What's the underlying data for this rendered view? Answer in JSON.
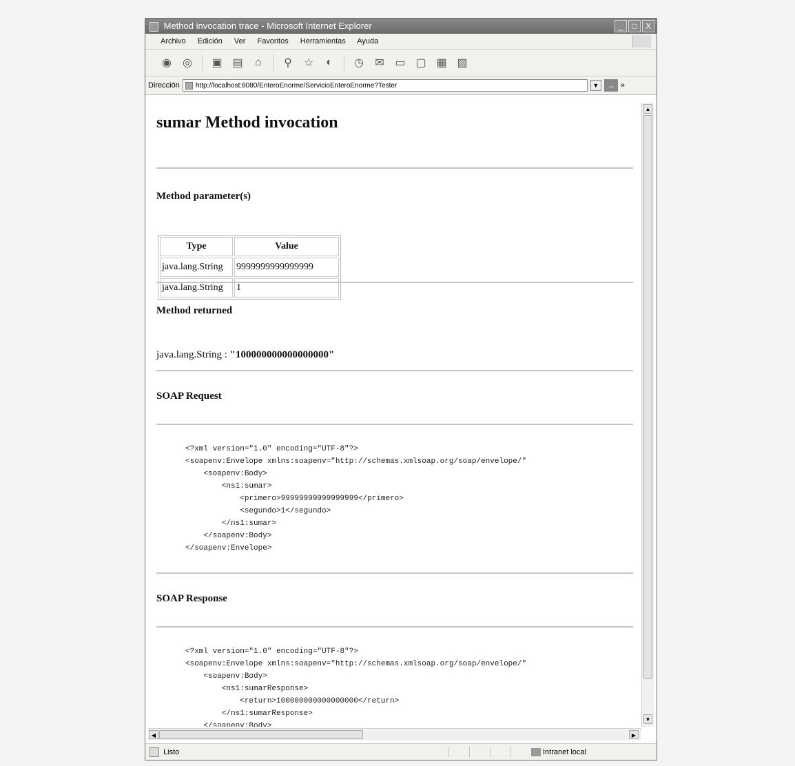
{
  "window": {
    "title": "Method invocation trace - Microsoft Internet Explorer",
    "controls": [
      "_",
      "□",
      "X"
    ]
  },
  "menu": [
    "Archivo",
    "Edición",
    "Ver",
    "Favoritos",
    "Herramientas",
    "Ayuda"
  ],
  "toolbar_icons": [
    "back-icon",
    "forward-icon",
    "stop-icon",
    "refresh-icon",
    "home-icon",
    "search-icon",
    "favorites-icon",
    "media-icon",
    "history-icon",
    "mail-icon",
    "print-icon",
    "edit-icon",
    "discuss-icon",
    "messenger-icon"
  ],
  "address": {
    "label": "Dirección",
    "url": "http://localhost:8080/EnteroEnorme/ServicioEnteroEnorme?Tester",
    "go_label": "→",
    "links_label": "»"
  },
  "page": {
    "title": "sumar Method invocation",
    "params_heading": "Method parameter(s)",
    "params_columns": [
      "Type",
      "Value"
    ],
    "params_rows": [
      {
        "type": "java.lang.String",
        "value": "9999999999999999"
      },
      {
        "type": "java.lang.String",
        "value": "1"
      }
    ],
    "returned_heading": "Method returned",
    "returned_type": "java.lang.String : ",
    "returned_value": "\"100000000000000000\"",
    "soap_request_heading": "SOAP Request",
    "soap_request": "<?xml version=\"1.0\" encoding=\"UTF-8\"?>\n<soapenv:Envelope xmlns:soapenv=\"http://schemas.xmlsoap.org/soap/envelope/\"\n    <soapenv:Body>\n        <ns1:sumar>\n            <primero>99999999999999999</primero>\n            <segundo>1</segundo>\n        </ns1:sumar>\n    </soapenv:Body>\n</soapenv:Envelope>",
    "soap_response_heading": "SOAP Response",
    "soap_response": "<?xml version=\"1.0\" encoding=\"UTF-8\"?>\n<soapenv:Envelope xmlns:soapenv=\"http://schemas.xmlsoap.org/soap/envelope/\"\n    <soapenv:Body>\n        <ns1:sumarResponse>\n            <return>100000000000000000</return>\n        </ns1:sumarResponse>\n    </soapenv:Body>\n</soapenv:Envelope>"
  },
  "status": {
    "text": "Listo",
    "zone": "Intranet local"
  }
}
